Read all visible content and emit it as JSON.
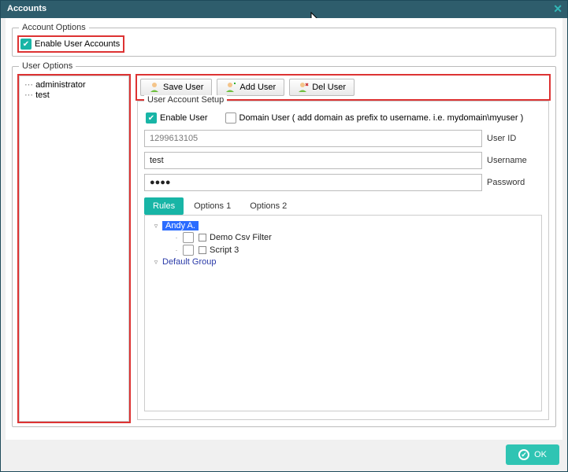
{
  "window": {
    "title": "Accounts"
  },
  "accountOptions": {
    "legend": "Account Options",
    "enable": {
      "label": "Enable User Accounts",
      "checked": true
    }
  },
  "userOptions": {
    "legend": "User Options",
    "users": [
      "administrator",
      "test"
    ],
    "buttons": {
      "save": "Save User",
      "add": "Add User",
      "del": "Del User"
    }
  },
  "setup": {
    "legend": "User Account Setup",
    "enableUser": {
      "label": "Enable User",
      "checked": true
    },
    "domainUser": {
      "label": "Domain User ( add domain as prefix to username. i.e. mydomain\\myuser )",
      "checked": false
    },
    "userId": {
      "value": "1299613105",
      "label": "User ID"
    },
    "username": {
      "value": "test",
      "label": "Username"
    },
    "password": {
      "value": "●●●●",
      "label": "Password"
    },
    "tabs": [
      "Rules",
      "Options 1",
      "Options 2"
    ],
    "tree": {
      "group1": "Andy A.",
      "item1": "Demo Csv Filter",
      "item2": "Script 3",
      "group2": "Default Group"
    }
  },
  "footer": {
    "ok": "OK"
  }
}
